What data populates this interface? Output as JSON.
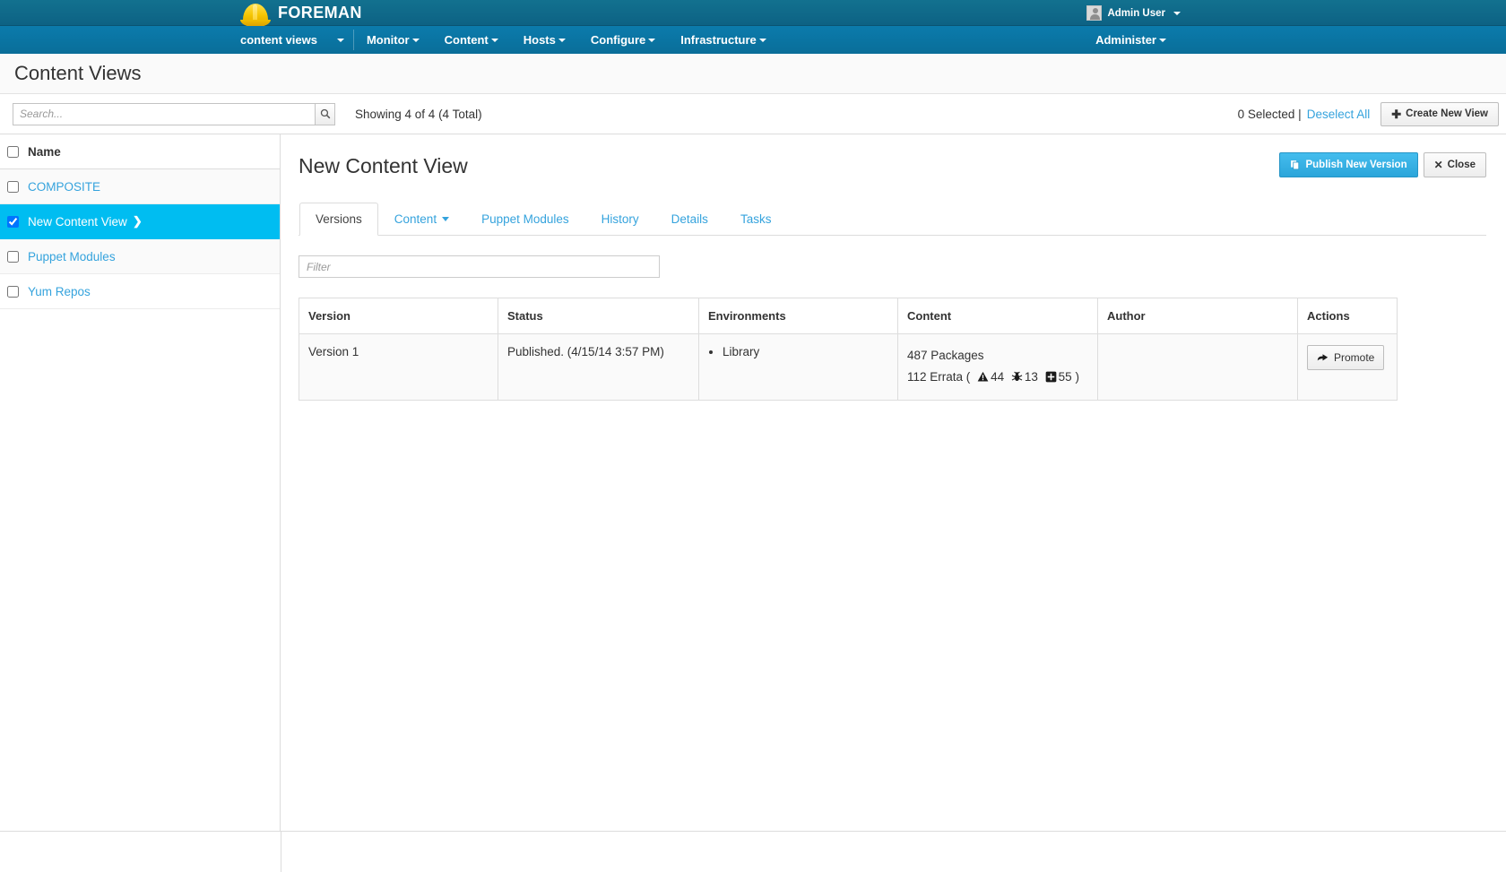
{
  "brand": {
    "name": "FOREMAN",
    "logo_icon": "hardhat-icon",
    "user": {
      "label": "Admin User",
      "avatar_icon": "user-avatar-icon",
      "caret_icon": "caret-down-icon"
    }
  },
  "nav": {
    "current_context": "content views",
    "items": [
      {
        "label": "Monitor",
        "caret": "caret-down-icon"
      },
      {
        "label": "Content",
        "caret": "caret-down-icon"
      },
      {
        "label": "Hosts",
        "caret": "caret-down-icon"
      },
      {
        "label": "Configure",
        "caret": "caret-down-icon"
      },
      {
        "label": "Infrastructure",
        "caret": "caret-down-icon"
      }
    ],
    "right": {
      "label": "Administer",
      "caret": "caret-down-icon"
    }
  },
  "page": {
    "title": "Content Views"
  },
  "toolbar": {
    "search_placeholder": "Search...",
    "search_value": "",
    "search_icon": "magnifier-icon",
    "showing_text": "Showing 4 of 4 (4 Total)",
    "selected_text": "0 Selected |",
    "deselect_label": "Deselect All",
    "create_label": "Create New View",
    "create_icon": "plus-icon"
  },
  "sidebar": {
    "header": {
      "label": "Name",
      "checkbox_checked": false
    },
    "items": [
      {
        "label": "COMPOSITE",
        "checked": false,
        "active": false,
        "chevron": ""
      },
      {
        "label": "New Content View",
        "checked": true,
        "active": true,
        "chevron": "❯"
      },
      {
        "label": "Puppet Modules",
        "checked": false,
        "active": false,
        "chevron": ""
      },
      {
        "label": "Yum Repos",
        "checked": false,
        "active": false,
        "chevron": ""
      }
    ]
  },
  "detail": {
    "title": "New Content View",
    "publish_label": "Publish New Version",
    "publish_icon": "copy-icon",
    "close_label": "Close",
    "close_icon": "x-icon",
    "tabs": [
      {
        "label": "Versions",
        "active": true,
        "has_caret": false
      },
      {
        "label": "Content",
        "active": false,
        "has_caret": true
      },
      {
        "label": "Puppet Modules",
        "active": false,
        "has_caret": false
      },
      {
        "label": "History",
        "active": false,
        "has_caret": false
      },
      {
        "label": "Details",
        "active": false,
        "has_caret": false
      },
      {
        "label": "Tasks",
        "active": false,
        "has_caret": false
      }
    ],
    "filter_placeholder": "Filter",
    "filter_value": "",
    "table": {
      "columns": [
        "Version",
        "Status",
        "Environments",
        "Content",
        "Author",
        "Actions"
      ],
      "rows": [
        {
          "version": "Version 1",
          "status": "Published. (4/15/14 3:57 PM)",
          "environments": [
            "Library"
          ],
          "content": {
            "packages": "487 Packages",
            "errata_prefix": "112 Errata (",
            "errata_suffix": ")",
            "errata": [
              {
                "icon": "security-warning-icon",
                "count": "44"
              },
              {
                "icon": "bug-icon",
                "count": "13"
              },
              {
                "icon": "enhancement-plus-icon",
                "count": "55"
              }
            ]
          },
          "author": "",
          "action_label": "Promote",
          "action_icon": "arrow-right-icon"
        }
      ]
    }
  },
  "colors": {
    "brand_bar": "#0f6a8c",
    "nav_bar": "#0a74a0",
    "accent_link": "#35a3dd",
    "selected_row": "#00bdf1",
    "primary_button": "#3ab3e8"
  }
}
